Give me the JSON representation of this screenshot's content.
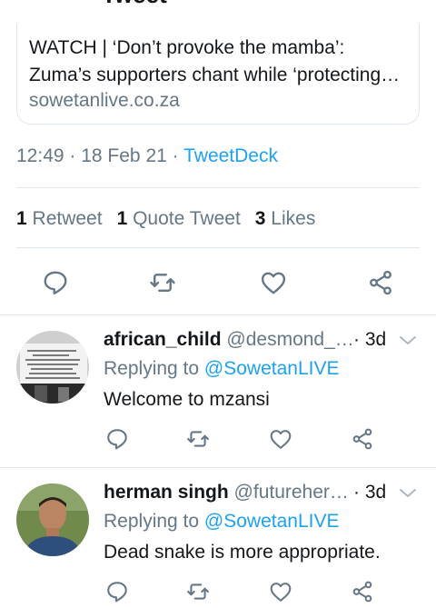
{
  "header": {
    "title": "Tweet"
  },
  "card": {
    "title_line1": "WATCH | ‘Don’t provoke the mamba’:",
    "title_line2": "Zuma’s supporters chant while ‘protecting…",
    "domain": "sowetanlive.co.za"
  },
  "meta": {
    "time": "12:49",
    "sep": " · ",
    "date": "18 Feb 21",
    "sep2": " · ",
    "source": "TweetDeck"
  },
  "stats": {
    "retweets_count": "1",
    "retweets_label": " Retweet",
    "quotes_count": "1",
    "quotes_label": " Quote Tweet",
    "likes_count": "3",
    "likes_label": " Likes"
  },
  "replies": [
    {
      "name": "african_child",
      "handle": " @desmond_…",
      "time": " · 3d",
      "replying_prefix": "Replying to ",
      "replying_to": "@SowetanLIVE",
      "text": "Welcome to mzansi"
    },
    {
      "name": "herman singh",
      "handle": " @futureher…",
      "time": " · 3d",
      "replying_prefix": "Replying to ",
      "replying_to": "@SowetanLIVE",
      "text": "Dead snake is more appropriate."
    }
  ],
  "colors": {
    "accent": "#1da1f2",
    "muted": "#657786",
    "text": "#14171a",
    "border": "#e1e8ed"
  },
  "icons": [
    "back-arrow-icon",
    "reply-icon",
    "retweet-icon",
    "like-icon",
    "share-icon",
    "chevron-down-icon"
  ]
}
